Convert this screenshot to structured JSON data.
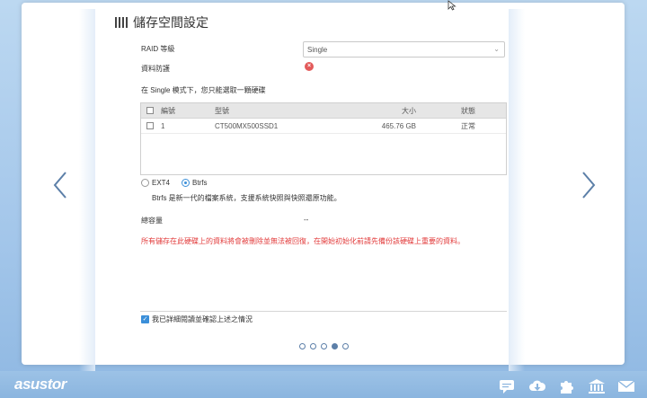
{
  "title": "儲存空間設定",
  "raid": {
    "label": "RAID 等級",
    "value": "Single"
  },
  "protection": {
    "label": "資料防護"
  },
  "mode_note": "在 Single 模式下，您只能選取一顆硬碟",
  "table": {
    "headers": {
      "no": "編號",
      "model": "型號",
      "size": "大小",
      "status": "狀態"
    },
    "rows": [
      {
        "no": "1",
        "model": "CT500MX500SSD1",
        "size": "465.76 GB",
        "status": "正常"
      }
    ]
  },
  "filesystem": {
    "option_ext4": "EXT4",
    "option_btrfs": "Btrfs",
    "selected": "Btrfs",
    "description": "Btrfs 是新一代的檔案系統，支援系統快照與快照還原功能。"
  },
  "capacity": {
    "label": "總容量",
    "value": "--"
  },
  "warning": "所有儲存在此硬碟上的資料將會被刪除並無法被回復，在開始初始化前請先備份該硬碟上重要的資料。",
  "confirm": {
    "label": "我已詳細閱讀並確認上述之情況",
    "checked": true
  },
  "pager": {
    "total": 5,
    "current": 4
  },
  "brand": "asustor",
  "colors": {
    "accent": "#3b8fd9",
    "warning": "#e23b3b",
    "error_icon": "#e35a5a"
  }
}
